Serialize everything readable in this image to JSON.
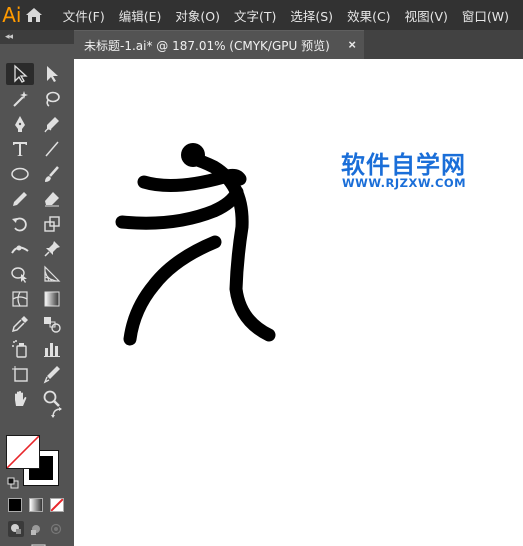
{
  "app": {
    "logo_text": "Ai",
    "logo_color": "#ff9a00"
  },
  "menu": {
    "items": [
      "文件(F)",
      "编辑(E)",
      "对象(O)",
      "文字(T)",
      "选择(S)",
      "效果(C)",
      "视图(V)",
      "窗口(W)"
    ]
  },
  "document_tab": {
    "title": "未标题-1.ai* @ 187.01% (CMYK/GPU 预览)",
    "close_label": "×"
  },
  "toolbar": {
    "collapse_label": "◂◂",
    "tools": [
      "selection-tool",
      "direct-selection-tool",
      "magic-wand-tool",
      "lasso-tool",
      "pen-tool",
      "curvature-tool",
      "type-tool",
      "line-segment-tool",
      "ellipse-tool",
      "paintbrush-tool",
      "pencil-tool",
      "eraser-tool",
      "rotate-tool",
      "scale-tool",
      "width-tool",
      "puppet-warp-tool",
      "shape-builder-tool",
      "perspective-grid-tool",
      "mesh-tool",
      "gradient-tool",
      "eyedropper-tool",
      "blend-tool",
      "symbol-sprayer-tool",
      "column-graph-tool",
      "artboard-tool",
      "slice-tool",
      "hand-tool",
      "zoom-tool"
    ],
    "fill_color": "none",
    "stroke_color": "#000000"
  },
  "canvas": {
    "background": "#ffffff",
    "artwork_color": "#000000",
    "watermark_title": "软件自学网",
    "watermark_url": "WWW.RJZXW.COM",
    "watermark_color": "#1a6ed8"
  }
}
